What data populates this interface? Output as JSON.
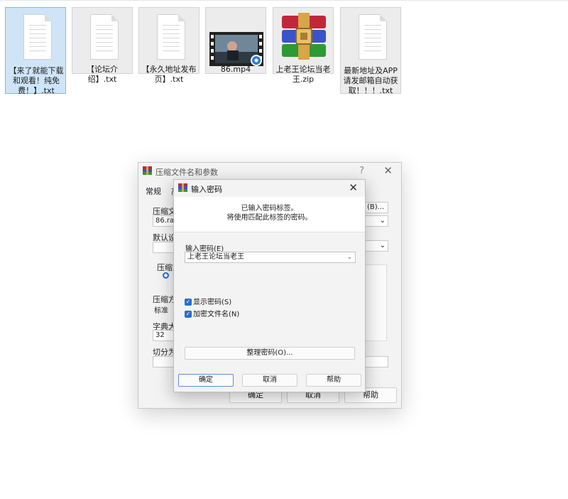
{
  "files": [
    {
      "name": "【来了就能下载和观看！纯免费！】.txt",
      "icon": "text-file-icon",
      "selected": true
    },
    {
      "name": "【论坛介绍】.txt",
      "icon": "text-file-icon"
    },
    {
      "name": "【永久地址发布页】.txt",
      "icon": "text-file-icon"
    },
    {
      "name": "86.mp4",
      "icon": "video-file-icon"
    },
    {
      "name": "上老王论坛当老王.zip",
      "icon": "winrar-archive-icon"
    },
    {
      "name": "最新地址及APP请发邮箱自动获取！！！.txt",
      "icon": "text-file-icon"
    }
  ],
  "back_dialog": {
    "title": "压缩文件名和参数",
    "help_symbol": "?",
    "close_symbol": "✕",
    "tabs": [
      "常规",
      "高"
    ],
    "archive_name_label": "压缩文",
    "archive_name_value": "86.rar",
    "browse_button": "(B)...",
    "default_label": "默认设",
    "format_label": "压缩文",
    "method_label": "压缩方",
    "method_value": "标准",
    "dict_label": "字典大",
    "dict_value": "32",
    "split_label": "切分为",
    "ok": "确定",
    "cancel": "取消",
    "help": "帮助"
  },
  "password_dialog": {
    "title": "输入密码",
    "close_symbol": "✕",
    "info_line1": "已输入密码标签。",
    "info_line2": "将使用匹配此标签的密码。",
    "password_label": "输入密码(E)",
    "password_value": "上老王论坛当老王",
    "show_password": "显示密码(S)",
    "encrypt_names": "加密文件名(N)",
    "organize_button": "整理密码(O)...",
    "ok": "确定",
    "cancel": "取消",
    "help": "帮助"
  }
}
